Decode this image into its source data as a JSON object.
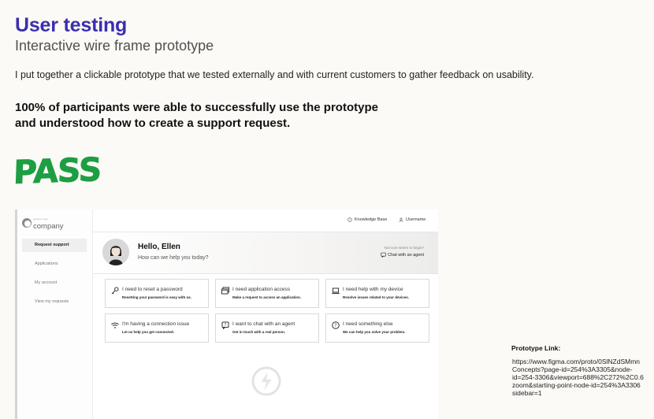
{
  "header": {
    "title": "User testing",
    "subtitle": "Interactive wire frame prototype",
    "intro": "I put together a clickable prototype that we tested externally and with current customers to gather feedback on usability.",
    "result_line1": "100% of participants were able to successfully use the prototype",
    "result_line2": "and understood how to create a support request.",
    "pass_label": "PASS"
  },
  "prototype": {
    "logo": {
      "tagline": "generic logo",
      "name": "company"
    },
    "sidebar": {
      "items": [
        {
          "label": "Request support",
          "active": true
        },
        {
          "label": "Applications",
          "active": false
        },
        {
          "label": "My account",
          "active": false
        },
        {
          "label": "View my requests",
          "active": false
        }
      ]
    },
    "topbar": {
      "knowledge_base": "Knowledge Base",
      "username": "Username"
    },
    "hero": {
      "greeting": "Hello, Ellen",
      "question": "How can we help you today?",
      "not_sure": "Not sure where to begin?",
      "chat_agent": "Chat with an agent"
    },
    "cards": [
      {
        "icon": "key-icon",
        "title": "I need to reset a password",
        "sub": "Resetting your password is easy with us."
      },
      {
        "icon": "app-window-icon",
        "title": "I need application access",
        "sub": "Make a request to access an application."
      },
      {
        "icon": "laptop-icon",
        "title": "I need help with my device",
        "sub": "Resolve issues related to your devices."
      },
      {
        "icon": "wifi-icon",
        "title": "I'm having a connection issue",
        "sub": "Let us help you get connected."
      },
      {
        "icon": "chat-question-icon",
        "title": "I want to chat with an agent",
        "sub": "Get in touch with a real person."
      },
      {
        "icon": "question-circle-icon",
        "title": "I need something else",
        "sub": "We can help you solve your problem."
      }
    ]
  },
  "link": {
    "label": "Prototype Link:",
    "url": "https://www.figma.com/proto/0SlNZdSMmn\nConcepts?page-id=254%3A3305&node-\nid=254-3306&viewport=688%2C272%2C0.6\nzoom&starting-point-node-id=254%3A3306\nsidebar=1"
  },
  "colors": {
    "title": "#3a2fb0",
    "pass": "#1e9e43",
    "background": "#fbfaf6"
  }
}
